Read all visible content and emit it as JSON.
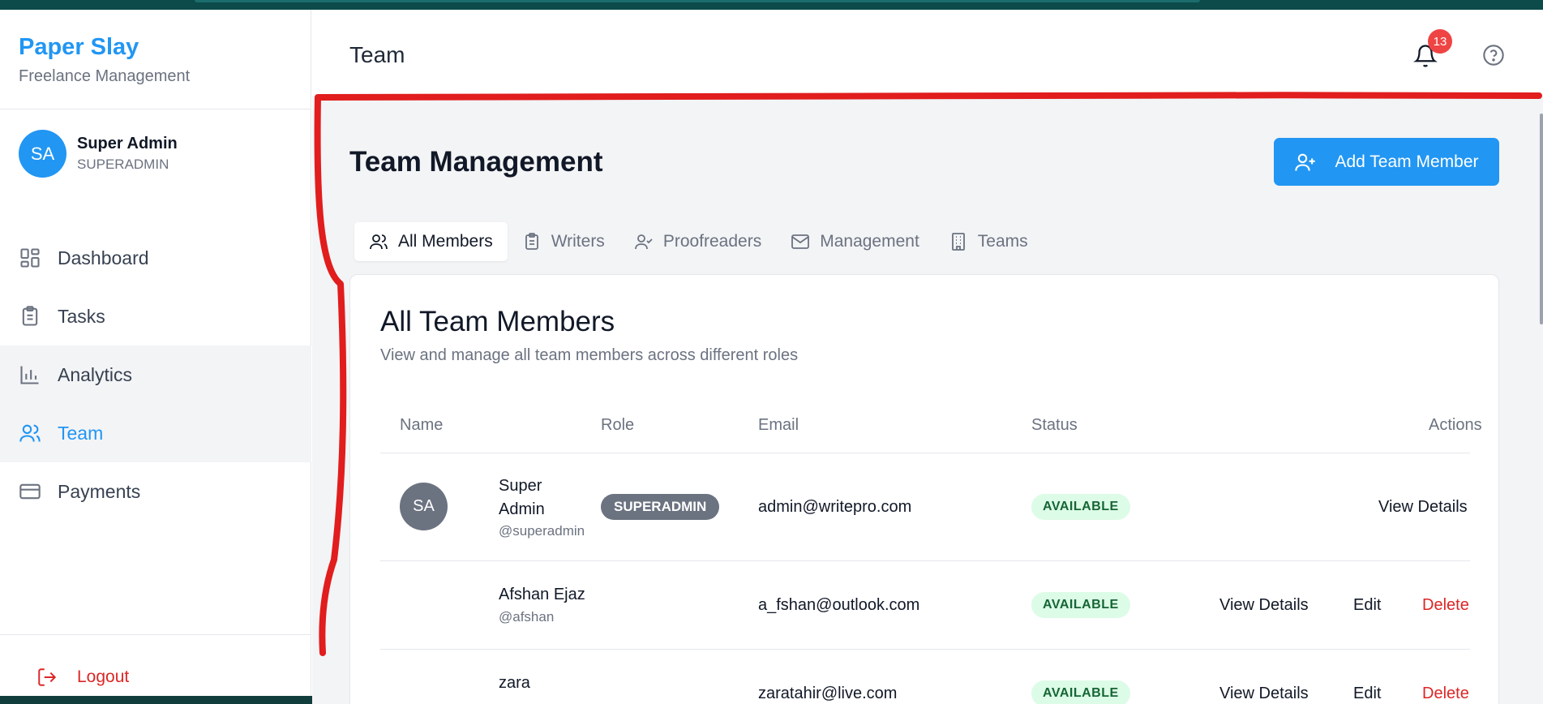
{
  "app": {
    "title": "Paper Slay",
    "subtitle": "Freelance Management"
  },
  "user": {
    "initials": "SA",
    "name": "Super Admin",
    "role": "SUPERADMIN"
  },
  "sidebar": {
    "items": [
      {
        "label": "Dashboard",
        "icon": "dashboard-icon"
      },
      {
        "label": "Tasks",
        "icon": "clipboard-icon"
      },
      {
        "label": "Analytics",
        "icon": "bar-chart-icon"
      },
      {
        "label": "Team",
        "icon": "users-icon",
        "active": true
      },
      {
        "label": "Payments",
        "icon": "credit-card-icon"
      }
    ],
    "logout_label": "Logout"
  },
  "header": {
    "title": "Team",
    "notification_count": "13"
  },
  "main": {
    "title": "Team Management",
    "add_button_label": "Add Team Member",
    "tabs": [
      {
        "label": "All Members",
        "icon": "users-icon",
        "active": true
      },
      {
        "label": "Writers",
        "icon": "clipboard-icon"
      },
      {
        "label": "Proofreaders",
        "icon": "user-check-icon"
      },
      {
        "label": "Management",
        "icon": "mail-icon"
      },
      {
        "label": "Teams",
        "icon": "building-icon"
      }
    ],
    "card": {
      "title": "All Team Members",
      "description": "View and manage all team members across different roles",
      "columns": [
        "Name",
        "Role",
        "Email",
        "Status",
        "Actions"
      ],
      "rows": [
        {
          "initials": "SA",
          "name_line1": "Super",
          "name_line2": "Admin",
          "handle": "@superadmin",
          "role": "SUPERADMIN",
          "email": "admin@writepro.com",
          "status": "AVAILABLE",
          "actions": [
            "View Details"
          ]
        },
        {
          "name": "Afshan Ejaz",
          "handle": "@afshan",
          "role": "",
          "email": "a_fshan@outlook.com",
          "status": "AVAILABLE",
          "actions": [
            "View Details",
            "Edit",
            "Delete"
          ]
        },
        {
          "name": "zara",
          "handle": "",
          "role": "",
          "email": "zaratahir@live.com",
          "status": "AVAILABLE",
          "actions": [
            "View Details",
            "Edit",
            "Delete"
          ]
        }
      ]
    }
  },
  "colors": {
    "accent": "#2196f3",
    "danger": "#dc2626",
    "status_bg": "#dcfce7",
    "status_text": "#166534",
    "annotation": "#e11d1d"
  }
}
